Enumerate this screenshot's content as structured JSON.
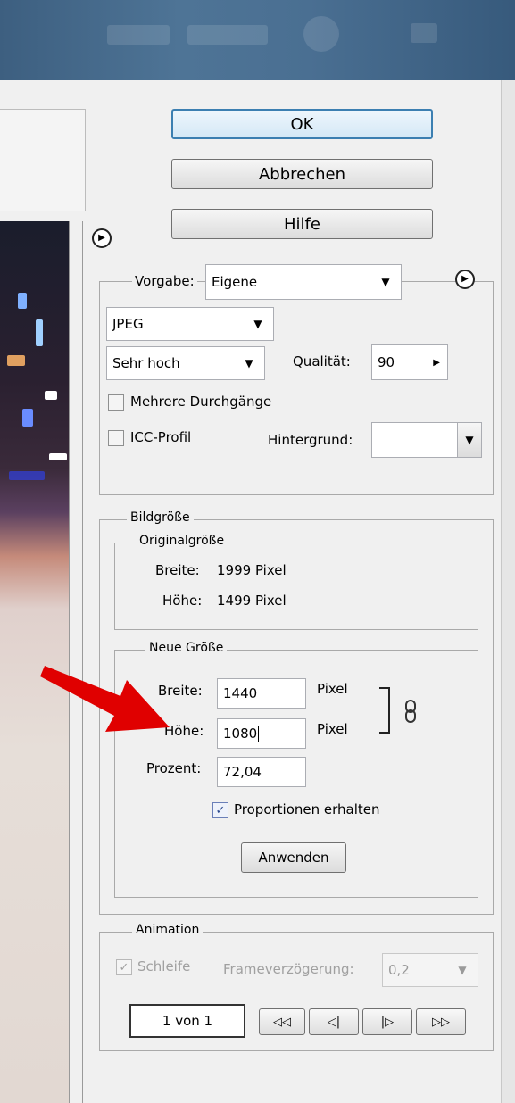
{
  "buttons": {
    "ok": "OK",
    "cancel": "Abbrechen",
    "help": "Hilfe",
    "apply": "Anwenden"
  },
  "settings": {
    "preset_label": "Vorgabe:",
    "preset_value": "Eigene",
    "format_value": "JPEG",
    "quality_preset_value": "Sehr hoch",
    "quality_label": "Qualität:",
    "quality_value": "90",
    "multipass_label": "Mehrere Durchgänge",
    "multipass_checked": false,
    "icc_label": "ICC-Profil",
    "icc_checked": false,
    "background_label": "Hintergrund:",
    "background_value": ""
  },
  "image_size": {
    "title": "Bildgröße",
    "original": {
      "title": "Originalgröße",
      "width_label": "Breite:",
      "width_value": "1999 Pixel",
      "height_label": "Höhe:",
      "height_value": "1499 Pixel"
    },
    "new": {
      "title": "Neue Größe",
      "width_label": "Breite:",
      "width_value": "1440",
      "width_unit": "Pixel",
      "height_label": "Höhe:",
      "height_value": "1080",
      "height_unit": "Pixel",
      "percent_label": "Prozent:",
      "percent_value": "72,04",
      "constrain_label": "Proportionen erhalten",
      "constrain_checked": true
    }
  },
  "animation": {
    "title": "Animation",
    "loop_label": "Schleife",
    "loop_checked": true,
    "frame_delay_label": "Frameverzögerung:",
    "frame_delay_value": "0,2",
    "frame_counter": "1 von 1",
    "nav": [
      "first-frame",
      "previous-frame",
      "next-frame",
      "last-frame"
    ]
  },
  "icons": {
    "menu_arrow": "circle-arrow-right-icon",
    "link": "chain-link-icon",
    "dropdown": "triangle-down-icon"
  },
  "colors": {
    "ok_border": "#3c7fb1",
    "annotation_arrow": "#e00000",
    "check_mark": "#2c4a8e"
  }
}
